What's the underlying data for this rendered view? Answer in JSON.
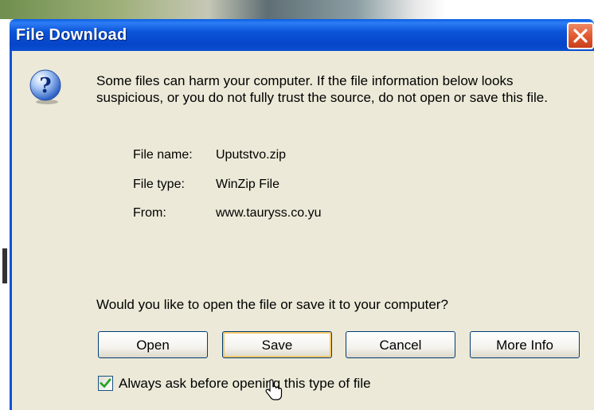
{
  "dialog": {
    "title": "File Download",
    "warning": "Some files can harm your computer. If the file information below looks suspicious, or you do not fully trust the source, do not open or save this file.",
    "file_info": {
      "name_label": "File name:",
      "name_value": "Uputstvo.zip",
      "type_label": "File type:",
      "type_value": "WinZip File",
      "from_label": "From:",
      "from_value": "www.tauryss.co.yu"
    },
    "question": "Would you like to open the file or save it to your computer?",
    "buttons": {
      "open": "Open",
      "save": "Save",
      "cancel": "Cancel",
      "more_info": "More Info"
    },
    "always_ask": {
      "label": "Always ask before opening this type of file",
      "checked": true
    }
  },
  "icons": {
    "question": "question-icon",
    "close": "close-icon",
    "checkmark": "checkmark-icon",
    "cursor": "mouse-pointer-icon"
  },
  "colors": {
    "titlebar": "#0a54d8",
    "close_button": "#e25a30",
    "dialog_background": "#ece9d8",
    "checkmark": "#21a121",
    "default_button_focus": "#f4c86a"
  }
}
